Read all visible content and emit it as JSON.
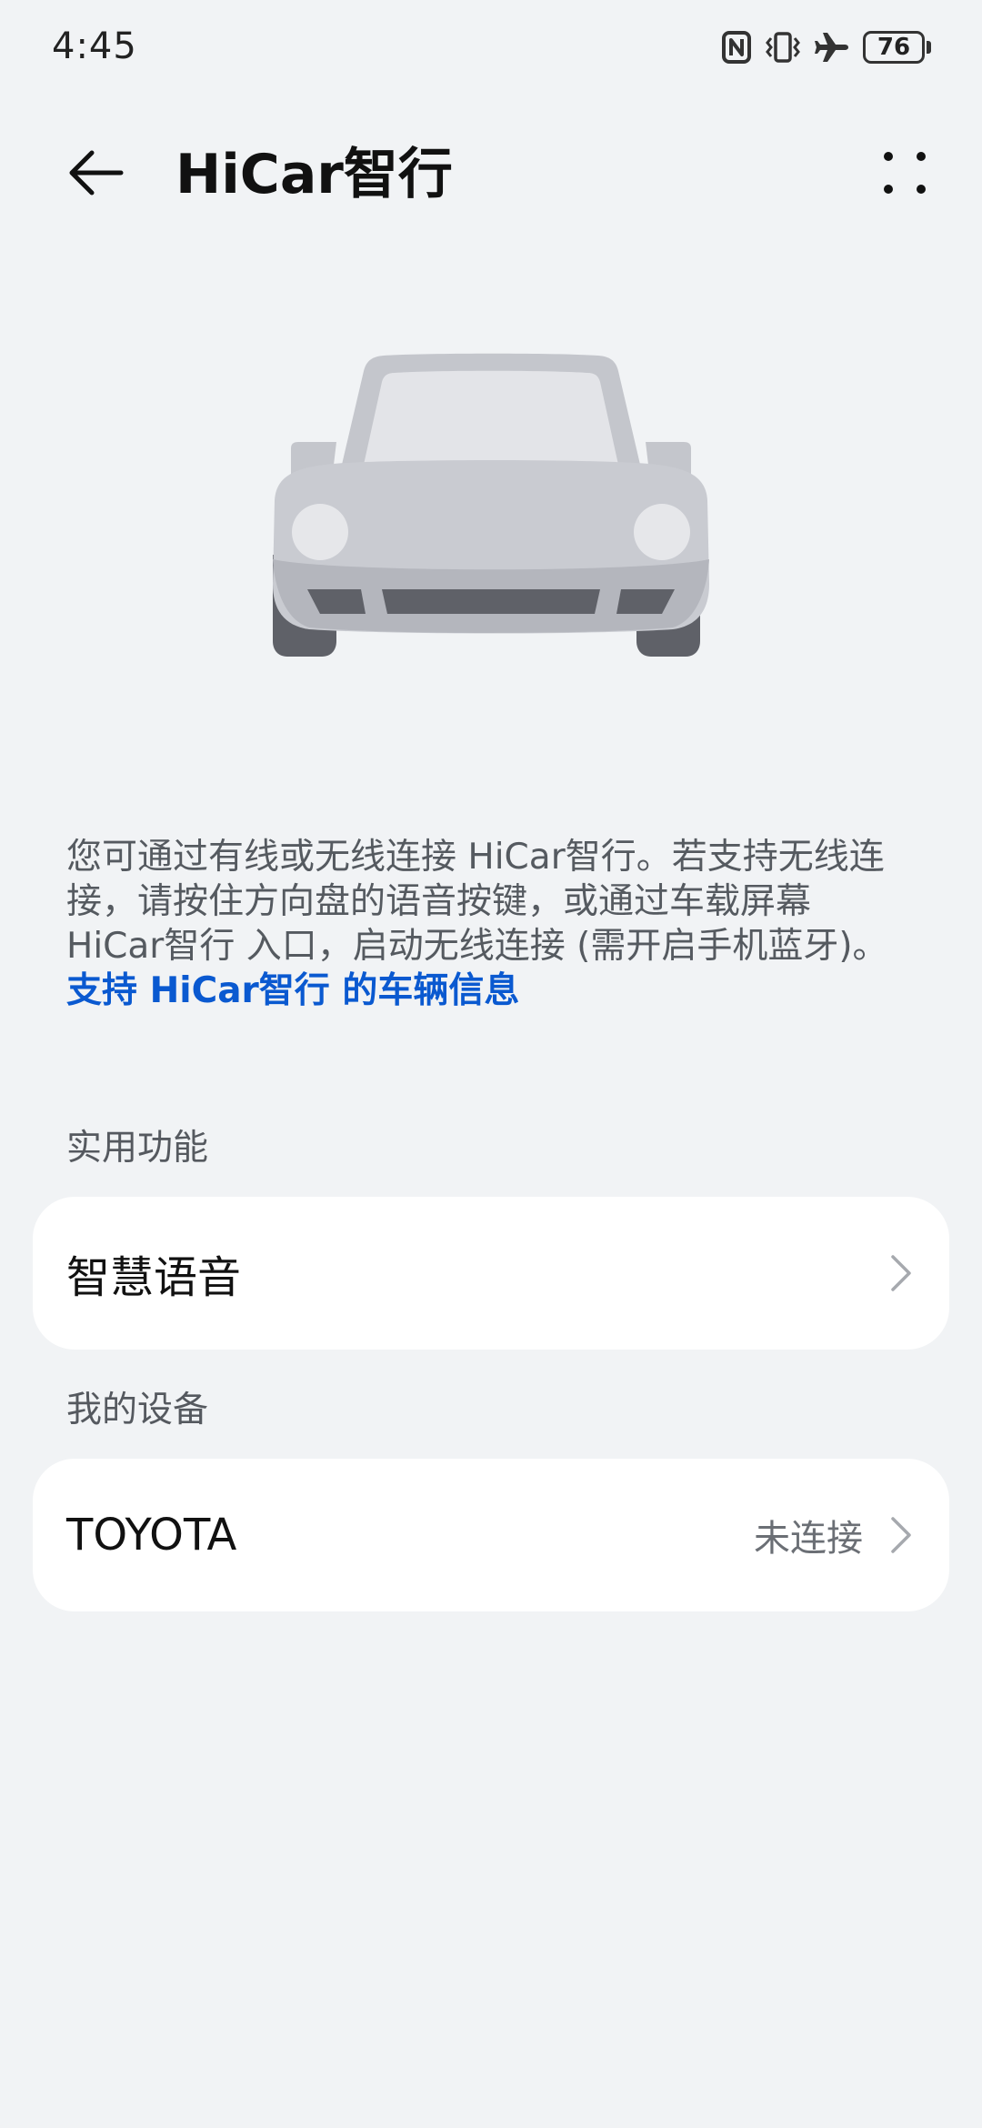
{
  "status_bar": {
    "time": "4:45",
    "battery": "76",
    "icons": [
      "nfc-icon",
      "vibrate-icon",
      "airplane-icon",
      "battery-icon"
    ]
  },
  "app_bar": {
    "title": "HiCar智行",
    "back_icon": "arrow-left-icon",
    "more_icon": "more-dots-icon"
  },
  "illustration": {
    "icon": "car-icon"
  },
  "description": {
    "text": "您可通过有线或无线连接 HiCar智行。若支持无线连接，请按住方向盘的语音按键，或通过车载屏幕 HiCar智行 入口，启动无线连接 (需开启手机蓝牙)。",
    "link_text": "支持 HiCar智行 的车辆信息"
  },
  "sections": {
    "features": {
      "header": "实用功能",
      "items": [
        {
          "label": "智慧语音"
        }
      ]
    },
    "devices": {
      "header": "我的设备",
      "items": [
        {
          "label": "TOYOTA",
          "status": "未连接"
        }
      ]
    }
  },
  "colors": {
    "background": "#f1f3f5",
    "card": "#ffffff",
    "link": "#0a59d0",
    "secondary_text": "#55595f"
  }
}
